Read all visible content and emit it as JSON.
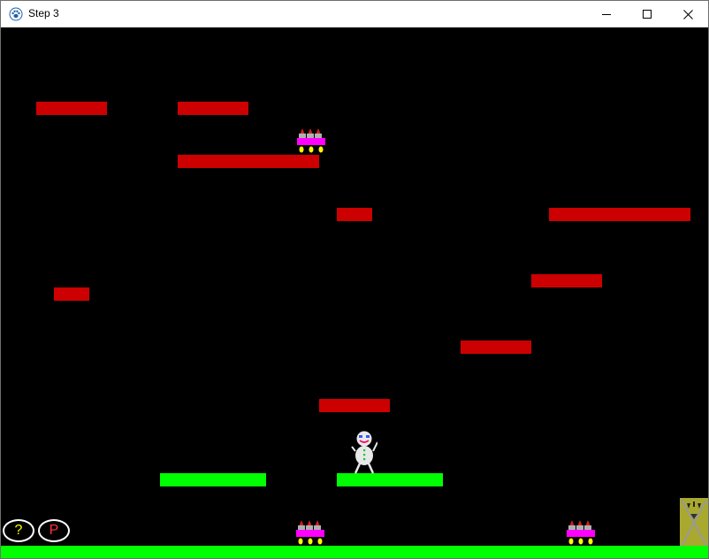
{
  "window": {
    "title": "Step 3",
    "app_icon": "paw-icon",
    "controls": [
      "minimize-icon",
      "maximize-icon",
      "close-icon"
    ]
  },
  "game": {
    "background_color": "#000000",
    "platform_colors": {
      "hazard": "#cc0000",
      "safe": "#00ff00"
    },
    "hud": {
      "help_label": "?",
      "pause_label": "P",
      "help_color": "#ffff00",
      "pause_color": "#ff3333"
    },
    "sprites": {
      "player": "snowman",
      "enemy": "spiked-cart",
      "exit": "exit-door"
    }
  }
}
